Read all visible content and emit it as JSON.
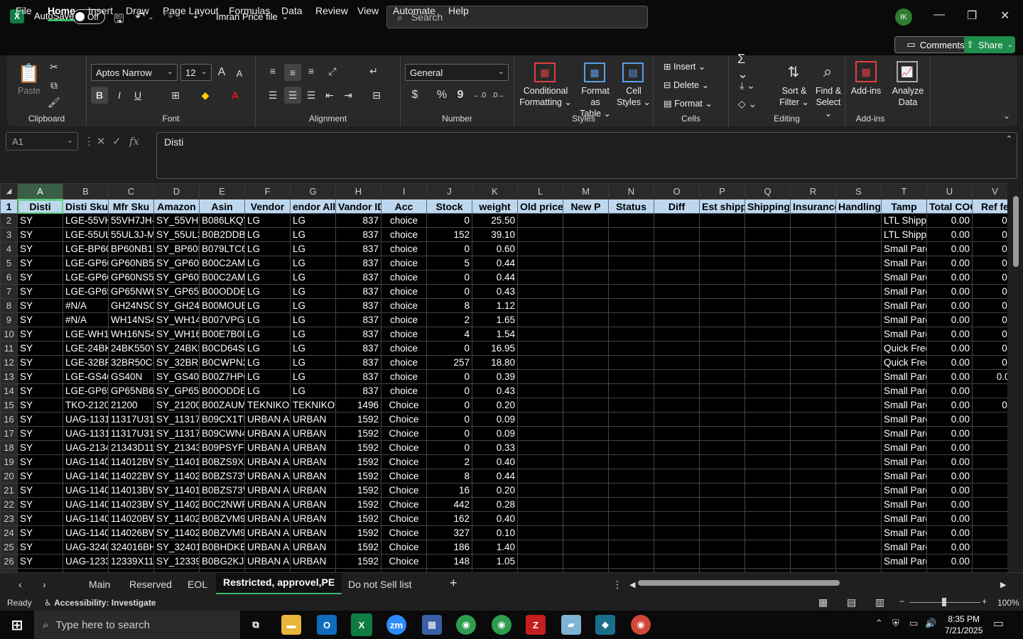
{
  "app": {
    "autosave_label": "AutoSave",
    "autosave_state": "Off",
    "file_name": "Imran Price file",
    "search_placeholder": "Search",
    "user_initials": "IK"
  },
  "menu": {
    "tabs": [
      "File",
      "Home",
      "Insert",
      "Draw",
      "Page Layout",
      "Formulas",
      "Data",
      "Review",
      "View",
      "Automate",
      "Help"
    ],
    "comments_label": "Comments",
    "share_label": "Share"
  },
  "ribbon": {
    "clipboard": {
      "paste": "Paste",
      "group": "Clipboard"
    },
    "font": {
      "name": "Aptos Narrow",
      "size": "12",
      "group": "Font",
      "bold": "B",
      "italic": "I",
      "underline": "U"
    },
    "alignment": {
      "group": "Alignment"
    },
    "number": {
      "format": "General",
      "group": "Number",
      "currency": "$",
      "percent": "%",
      "comma": "9"
    },
    "styles": {
      "conditional": "Conditional",
      "conditional2": "Formatting",
      "format_table": "Format as",
      "format_table2": "Table",
      "cell_styles": "Cell",
      "cell_styles2": "Styles",
      "group": "Styles"
    },
    "cells": {
      "insert": "Insert",
      "delete": "Delete",
      "format": "Format",
      "group": "Cells"
    },
    "editing": {
      "sort": "Sort &",
      "sort2": "Filter",
      "find": "Find &",
      "find2": "Select",
      "group": "Editing"
    },
    "addins": {
      "addins": "Add-ins",
      "analyze": "Analyze",
      "analyze2": "Data",
      "group": "Add-ins"
    }
  },
  "formula_bar": {
    "name_box": "A1",
    "content": "Disti"
  },
  "sheet": {
    "columns": [
      "A",
      "B",
      "C",
      "D",
      "E",
      "F",
      "G",
      "H",
      "I",
      "J",
      "K",
      "L",
      "M",
      "N",
      "O",
      "P",
      "Q",
      "R",
      "S",
      "T",
      "U",
      "V"
    ],
    "headers": [
      "Disti",
      "Disti Sku",
      "Mfr Sku",
      "Amazon",
      "Asin",
      "Vendor",
      "endor Allia",
      "Vandor ID",
      "Acc",
      "Stock",
      "weight",
      "Old price",
      "New P",
      "Status",
      "Diff",
      "Est shipp",
      "Shipping",
      "Insurance",
      "Handling",
      "Tamp",
      "Total COG",
      "Ref fe"
    ],
    "rows": [
      [
        "SY",
        "LGE-55VH7",
        "55VH7JH-4",
        "SY_55VH7J",
        "B086LKQV",
        "LG",
        "LG",
        "837",
        "choice",
        "0",
        "25.50",
        "",
        "",
        "",
        "",
        "",
        "",
        "",
        "",
        "LTL Shippi",
        "0.00",
        "0.0"
      ],
      [
        "SY",
        "LGE-55UL3",
        "55UL3J-M",
        "SY_55UL3J",
        "B0B2DDB0",
        "LG",
        "LG",
        "837",
        "choice",
        "152",
        "39.10",
        "",
        "",
        "",
        "",
        "",
        "",
        "",
        "",
        "LTL Shippi",
        "0.00",
        "0.0"
      ],
      [
        "SY",
        "LGE-BP60N",
        "BP60NB10",
        "SY_BP60N",
        "B079LTC6N",
        "LG",
        "LG",
        "837",
        "choice",
        "0",
        "0.60",
        "",
        "",
        "",
        "",
        "",
        "",
        "",
        "",
        "Small Parc",
        "0.00",
        "0.0"
      ],
      [
        "SY",
        "LGE-GP60N",
        "GP60NB50",
        "SY_GP60N",
        "B00C2AMK",
        "LG",
        "LG",
        "837",
        "choice",
        "5",
        "0.44",
        "",
        "",
        "",
        "",
        "",
        "",
        "",
        "",
        "Small Parc",
        "0.00",
        "0.0"
      ],
      [
        "SY",
        "LGE-GP60N",
        "GP60NS50",
        "SY_GP60N",
        "B00C2AMK",
        "LG",
        "LG",
        "837",
        "choice",
        "0",
        "0.44",
        "",
        "",
        "",
        "",
        "",
        "",
        "",
        "",
        "Small Parc",
        "0.00",
        "0.0"
      ],
      [
        "SY",
        "LGE-GP65N",
        "GP65NW6",
        "SY_GP65N",
        "B00ODDEA",
        "LG",
        "LG",
        "837",
        "choice",
        "0",
        "0.43",
        "",
        "",
        "",
        "",
        "",
        "",
        "",
        "",
        "Small Parc",
        "0.00",
        "0.0"
      ],
      [
        "SY",
        "#N/A",
        "GH24NSC0",
        "SY_GH24N",
        "B00MOUB",
        "LG",
        "LG",
        "837",
        "choice",
        "8",
        "1.12",
        "",
        "",
        "",
        "",
        "",
        "",
        "",
        "",
        "Small Parc",
        "0.00",
        "0.0"
      ],
      [
        "SY",
        "#N/A",
        "WH14NS40",
        "SY_WH14N",
        "B007VPGL",
        "LG",
        "LG",
        "837",
        "choice",
        "2",
        "1.65",
        "",
        "",
        "",
        "",
        "",
        "",
        "",
        "",
        "Small Parc",
        "0.00",
        "0.0"
      ],
      [
        "SY",
        "LGE-WH16",
        "WH16NS40",
        "SY_WH16N",
        "B00E7B08",
        "LG",
        "LG",
        "837",
        "choice",
        "4",
        "1.54",
        "",
        "",
        "",
        "",
        "",
        "",
        "",
        "",
        "Small Parc",
        "0.00",
        "0.0"
      ],
      [
        "SY",
        "LGE-24BK5",
        "24BK550Y-",
        "SY_24BK55",
        "B0CD64S6",
        "LG",
        "LG",
        "837",
        "choice",
        "0",
        "16.95",
        "",
        "",
        "",
        "",
        "",
        "",
        "",
        "",
        "Quick Free",
        "0.00",
        "0.0"
      ],
      [
        "SY",
        "LGE-32BR5",
        "32BR50C-E",
        "SY_32BR50",
        "B0CWPN2",
        "LG",
        "LG",
        "837",
        "choice",
        "257",
        "18.80",
        "",
        "",
        "",
        "",
        "",
        "",
        "",
        "",
        "Quick Free",
        "0.00",
        "0.0"
      ],
      [
        "SY",
        "LGE-GS40N",
        "GS40N",
        "SY_GS40N",
        "B00Z7HPQ",
        "LG",
        "LG",
        "837",
        "choice",
        "0",
        "0.39",
        "",
        "",
        "",
        "",
        "",
        "",
        "",
        "",
        "Small Parc",
        "0.00",
        "0.08"
      ],
      [
        "SY",
        "LGE-GP65N",
        "GP65NB60",
        "SY_GP65N",
        "B00ODDE3",
        "LG",
        "LG",
        "837",
        "choice",
        "0",
        "0.43",
        "",
        "",
        "",
        "",
        "",
        "",
        "",
        "",
        "Small Parc",
        "0.00",
        "0."
      ],
      [
        "SY",
        "TKO-21200",
        "21200",
        "SY_21200",
        "B00ZAUMI",
        "TEKNIKOS",
        "TEKNIKOS",
        "1496",
        "Choice",
        "0",
        "0.20",
        "",
        "",
        "",
        "",
        "",
        "",
        "",
        "",
        "Small Parc",
        "0.00",
        "0.0"
      ],
      [
        "SY",
        "UAG-11317",
        "11317U313",
        "SY_11317U",
        "B09CX1TK",
        "URBAN AR",
        "URBAN",
        "1592",
        "Choice",
        "0",
        "0.09",
        "",
        "",
        "",
        "",
        "",
        "",
        "",
        "",
        "Small Parc",
        "0.00",
        "0."
      ],
      [
        "SY",
        "UAG-11317",
        "11317U317",
        "SY_11317U",
        "B09CWN4",
        "URBAN AR",
        "URBAN",
        "1592",
        "Choice",
        "0",
        "0.09",
        "",
        "",
        "",
        "",
        "",
        "",
        "",
        "",
        "Small Parc",
        "0.00",
        "0."
      ],
      [
        "SY",
        "UAG-21343",
        "21343D114",
        "SY_21343D",
        "B09PSYFX",
        "URBAN AR",
        "URBAN",
        "1592",
        "Choice",
        "0",
        "0.33",
        "",
        "",
        "",
        "",
        "",
        "",
        "",
        "",
        "Small Parc",
        "0.00",
        "0."
      ],
      [
        "SY",
        "UAG-11401",
        "114012BW",
        "SY_114012",
        "B0BZS9XR",
        "URBAN AR",
        "URBAN",
        "1592",
        "Choice",
        "2",
        "0.40",
        "",
        "",
        "",
        "",
        "",
        "",
        "",
        "",
        "Small Parc",
        "0.00",
        "0."
      ],
      [
        "SY",
        "UAG-11402",
        "114022BW",
        "SY_114022",
        "B0BZS73V",
        "URBAN AR",
        "URBAN",
        "1592",
        "Choice",
        "8",
        "0.44",
        "",
        "",
        "",
        "",
        "",
        "",
        "",
        "",
        "Small Parc",
        "0.00",
        "0."
      ],
      [
        "SY",
        "UAG-11401",
        "114013BW",
        "SY_114013",
        "B0BZS73V",
        "URBAN AR",
        "URBAN",
        "1592",
        "Choice",
        "16",
        "0.20",
        "",
        "",
        "",
        "",
        "",
        "",
        "",
        "",
        "Small Parc",
        "0.00",
        "0."
      ],
      [
        "SY",
        "UAG-11402",
        "114023BW",
        "SY_114023",
        "B0C2NWP",
        "URBAN AR",
        "URBAN",
        "1592",
        "Choice",
        "442",
        "0.28",
        "",
        "",
        "",
        "",
        "",
        "",
        "",
        "",
        "Small Parc",
        "0.00",
        "0."
      ],
      [
        "SY",
        "UAG-11402",
        "114020BW",
        "SY_114020",
        "B0BZVM92",
        "URBAN AR",
        "URBAN",
        "1592",
        "Choice",
        "162",
        "0.40",
        "",
        "",
        "",
        "",
        "",
        "",
        "",
        "",
        "Small Parc",
        "0.00",
        "0."
      ],
      [
        "SY",
        "UAG-11402",
        "114026BW",
        "SY_114026",
        "B0BZVM92",
        "URBAN AR",
        "URBAN",
        "1592",
        "Choice",
        "327",
        "0.10",
        "",
        "",
        "",
        "",
        "",
        "",
        "",
        "",
        "Small Parc",
        "0.00",
        "0."
      ],
      [
        "SY",
        "UAG-32401",
        "324016BH",
        "SY_324016",
        "B0BHDKB",
        "URBAN AR",
        "URBAN",
        "1592",
        "Choice",
        "186",
        "1.40",
        "",
        "",
        "",
        "",
        "",
        "",
        "",
        "",
        "Small Parc",
        "0.00",
        "0."
      ],
      [
        "SY",
        "UAG-12339",
        "12339X114",
        "SY_12339X",
        "B0BG2KJP",
        "URBAN AR",
        "URBAN",
        "1592",
        "Choice",
        "148",
        "1.05",
        "",
        "",
        "",
        "",
        "",
        "",
        "",
        "",
        "Small Parc",
        "0.00",
        "0."
      ]
    ]
  },
  "sheet_tabs": [
    "Main",
    "Reserved",
    "EOL",
    "Restricted, approvel,PE",
    "Do not Sell list"
  ],
  "active_sheet_tab": "Restricted, approvel,PE",
  "status": {
    "ready": "Ready",
    "accessibility": "Accessibility: Investigate",
    "zoom": "100%"
  },
  "taskbar": {
    "search_placeholder": "Type here to search",
    "time": "8:35 PM",
    "date": "7/21/2025"
  }
}
